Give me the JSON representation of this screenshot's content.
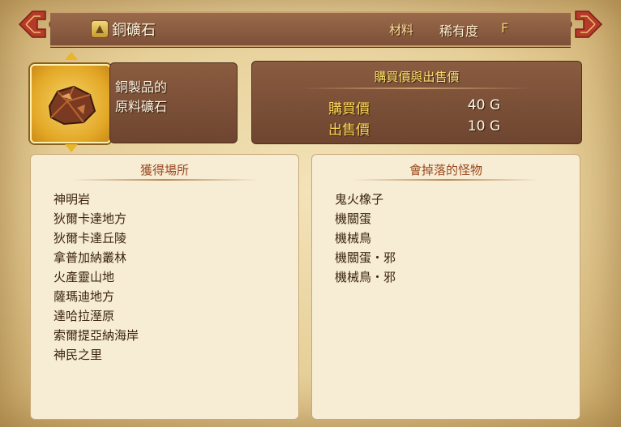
{
  "header": {
    "item_name": "銅礦石",
    "category": "材料",
    "rarity_label": "稀有度",
    "rarity_value": "F"
  },
  "item": {
    "image": "copper-ore-icon",
    "description": [
      "銅製品的",
      "原料礦石"
    ]
  },
  "prices": {
    "title": "購買價與出售價",
    "buy_label": "購買價",
    "buy_value": "40 G",
    "sell_label": "出售價",
    "sell_value": "10 G"
  },
  "locations": {
    "title": "獲得場所",
    "items": [
      "神明岩",
      "狄爾卡達地方",
      "狄爾卡達丘陵",
      "拿普加納叢林",
      "火產靈山地",
      "薩瑪迪地方",
      "達哈拉溼原",
      "索爾提亞納海岸",
      "神民之里"
    ]
  },
  "monsters": {
    "title": "會掉落的怪物",
    "items": [
      "鬼火橡子",
      "機關蛋",
      "機械鳥",
      "機關蛋・邪",
      "機械鳥・邪"
    ]
  },
  "colors": {
    "accent_gold": "#e9b52a",
    "panel_brown": "#7d5038",
    "list_bg": "#f7ecd4"
  }
}
